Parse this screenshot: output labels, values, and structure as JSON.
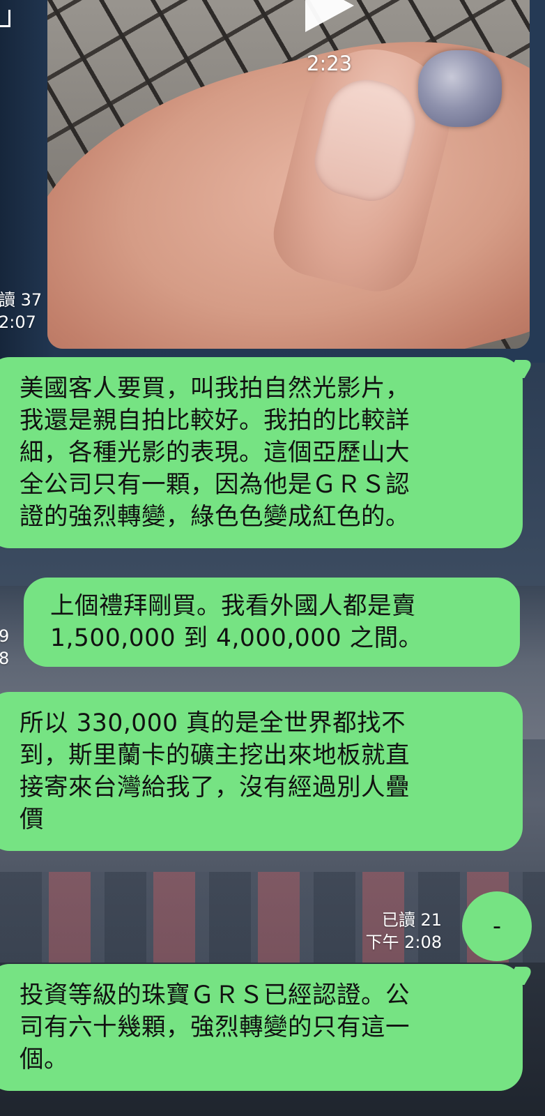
{
  "video": {
    "duration": "2:23",
    "play_icon": "play-icon"
  },
  "left_meta": {
    "read_top": "讀 37",
    "time_top": "2:07",
    "read_mid": "9",
    "time_mid": "8"
  },
  "messages": [
    {
      "lines": [
        "美國客人要買，叫我拍自然光影片，",
        "我還是親自拍比較好。我拍的比較詳",
        "細，各種光影的表現。這個亞歷山大",
        "全公司只有一顆，因為他是ＧＲＳ認",
        "證的強烈轉變，綠色色變成紅色的。"
      ]
    },
    {
      "lines": [
        "上個禮拜剛買。我看外國人都是賣",
        "1,500,000 到 4,000,000 之間。"
      ]
    },
    {
      "lines": [
        "所以 330,000 真的是全世界都找不",
        "到，斯里蘭卡的礦主挖出來地板就直",
        "接寄來台灣給我了，沒有經過別人疊",
        "價"
      ]
    },
    {
      "lines": [
        "投資等級的珠寶ＧＲＳ已經認證。公",
        "司有六十幾顆，強烈轉變的只有這一",
        "個。"
      ]
    }
  ],
  "sent": {
    "read_label": "已讀 21",
    "time": "下午 2:08",
    "text": "-"
  },
  "colors": {
    "bubble_green": "#76e383"
  }
}
